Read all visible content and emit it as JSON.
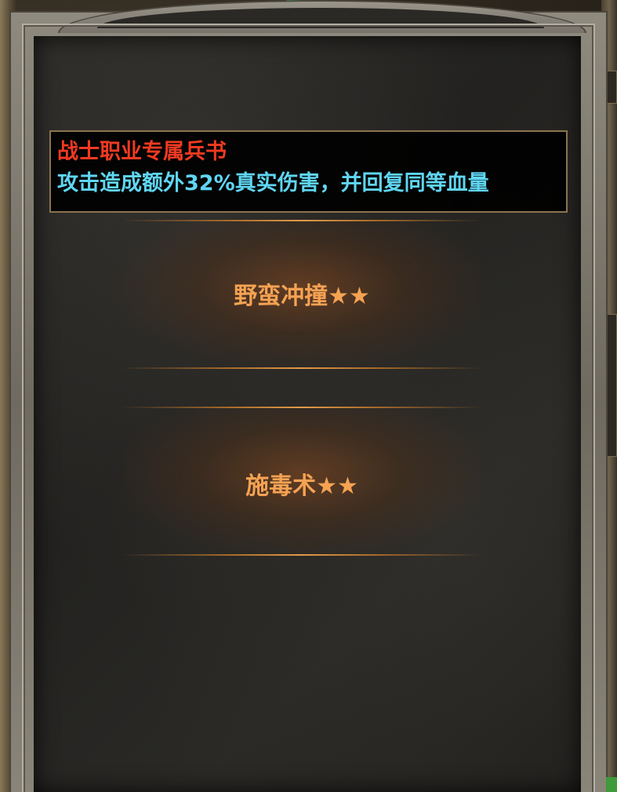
{
  "tooltip": {
    "title": "战士职业专属兵书",
    "description": "攻击造成额外32%真实伤害，并回复同等血量"
  },
  "skills": [
    {
      "name": "野蛮冲撞",
      "stars": "★★",
      "star_count": 2
    },
    {
      "name": "施毒术",
      "stars": "★★",
      "star_count": 2
    }
  ],
  "colors": {
    "tooltip_title": "#f03a22",
    "tooltip_description": "#5fd6f2",
    "skill_label": "#f5a253",
    "tooltip_border": "#8b7350"
  }
}
